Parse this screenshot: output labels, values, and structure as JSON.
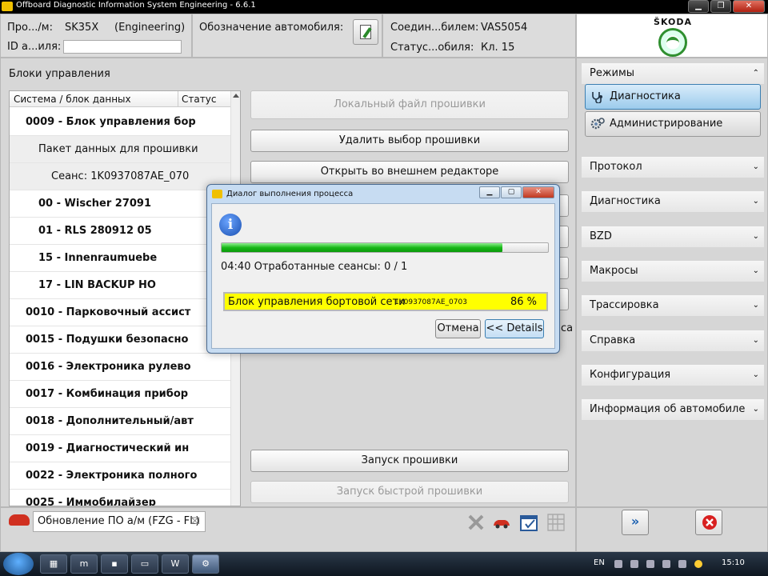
{
  "window": {
    "title": "Offboard Diagnostic Information System Engineering - 6.6.1"
  },
  "header": {
    "profile_label": "Про.../м:",
    "profile_value": "SK35X",
    "profile_mode": "(Engineering)",
    "id_label": "ID а...иля:",
    "vehicle_label": "Обозначение автомобиля:",
    "connection_label": "Соедин...билем:",
    "connection_value": "VAS5054",
    "status_label": "Статус...обиля:",
    "status_value": "Кл. 15",
    "brand": "ŠKODA"
  },
  "main": {
    "title": "Блоки управления",
    "col_system": "Система / блок данных",
    "col_status": "Статус",
    "rows": [
      {
        "text": "0009 - Блок управления бор"
      },
      {
        "text": "Пакет данных для прошивки"
      },
      {
        "text": "Сеанс: 1K0937087AE_070"
      },
      {
        "text": "00 - Wischer 27091"
      },
      {
        "text": "01 - RLS 280912 05"
      },
      {
        "text": "15 - Innenraumuebe"
      },
      {
        "text": "17 - LIN BACKUP HO"
      },
      {
        "text": "0010 - Парковочный ассист"
      },
      {
        "text": "0015 - Подушки безопасно"
      },
      {
        "text": "0016 - Электроника рулево"
      },
      {
        "text": "0017 - Комбинация прибор"
      },
      {
        "text": "0018 - Дополнительный/авт"
      },
      {
        "text": "0019 - Диагностический ин"
      },
      {
        "text": "0022 - Электроника полного"
      },
      {
        "text": "0025 - Иммобилайзер"
      }
    ],
    "buttons": {
      "local_file": "Локальный файл прошивки",
      "delete_selection": "Удалить выбор прошивки",
      "open_external": "Открыть во внешнем редакторе",
      "start_flash": "Запуск прошивки",
      "start_quick_flash": "Запуск быстрой прошивки",
      "hidden_tail": "са"
    }
  },
  "sidebar": {
    "modes_header": "Режимы",
    "diagnostics_btn": "Диагностика",
    "admin_btn": "Администрирование",
    "sections": [
      "Протокол",
      "Диагностика",
      "BZD",
      "Макросы",
      "Трассировка",
      "Справка",
      "Конфигурация",
      "Информация об автомобиле"
    ]
  },
  "bottom": {
    "tab_label": "Обновление ПО а/м (FZG - FL)"
  },
  "dialog": {
    "title": "Диалог выполнения процесса",
    "progress": 0.86,
    "elapsed": "04:40",
    "sessions_text": "Отработанные сеансы: 0 / 1",
    "module": "Блок управления бортовой сети",
    "session_id": "1K0937087AE_0703",
    "percent": "86 %",
    "cancel": "Отмена",
    "details": "<< Details"
  },
  "taskbar": {
    "lang": "EN",
    "time": "15:10"
  },
  "colors": {
    "progress": "#18b818",
    "highlight": "#ffff00",
    "accent": "#3c7fb1"
  }
}
